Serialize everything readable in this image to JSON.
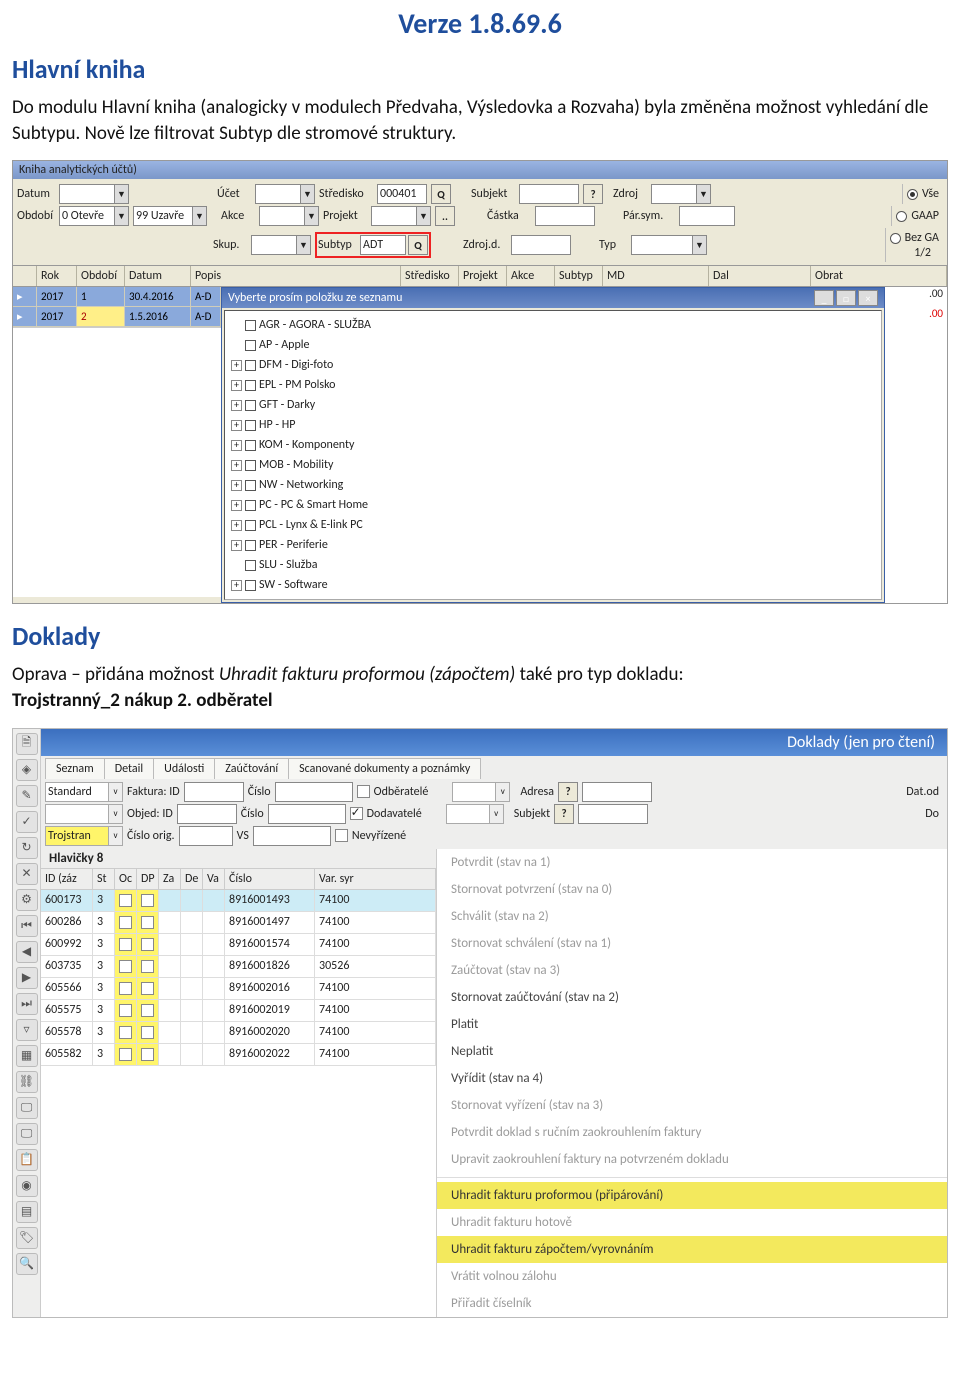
{
  "version": "Verze 1.8.69.6",
  "section1_heading": "Hlavní kniha",
  "section1_body": "Do modulu Hlavní kniha (analogicky v modulech Předvaha, Výsledovka a Rozvaha) byla změněna možnost vyhledání dle Subtypu. Nově lze filtrovat Subtyp dle stromové struktury.",
  "shot1": {
    "winTitle": "Kniha analytických účtů)",
    "labels": {
      "datum": "Datum",
      "obdobi": "Období",
      "ucet": "Účet",
      "stredisko": "Středisko",
      "subjekt": "Subjekt",
      "zdroj": "Zdroj",
      "akce": "Akce",
      "projekt": "Projekt",
      "castka": "Částka",
      "parsym": "Pár.sym.",
      "skup": "Skup.",
      "subtyp": "Subtyp",
      "zdrojd": "Zdroj.d.",
      "typ": "Typ"
    },
    "values": {
      "obdobiFrom": "0 Otevře",
      "obdobiTo": "99 Uzavře",
      "stredisko": "000401",
      "subtyp": "ADT"
    },
    "radios": {
      "vse": "Vše",
      "gaap": "GAAP",
      "bezga": "Bez GA"
    },
    "olap": "1/2",
    "columns": [
      "Rok",
      "Období",
      "Datum",
      "Popis",
      "Středisko",
      "Projekt",
      "Akce",
      "Subtyp",
      "MD",
      "Dal",
      "Obrat"
    ],
    "rows": [
      {
        "rok": "2017",
        "obdobi": "1",
        "datum": "30.4.2016",
        "popis": "A-D"
      },
      {
        "rok": "2017",
        "obdobi": "2",
        "datum": "1.5.2016",
        "popis": "A-D"
      }
    ],
    "rightcol": [
      ".00",
      ".00"
    ],
    "popup_title": "Vyberte prosím položku ze seznamu",
    "tree": [
      {
        "exp": "",
        "label": "AGR - AGORA - SLUŽBA"
      },
      {
        "exp": "",
        "label": "AP - Apple"
      },
      {
        "exp": "+",
        "label": "DFM - Digi-foto"
      },
      {
        "exp": "+",
        "label": "EPL - PM Polsko"
      },
      {
        "exp": "+",
        "label": "GFT - Darky"
      },
      {
        "exp": "+",
        "label": "HP - HP"
      },
      {
        "exp": "+",
        "label": "KOM - Komponenty"
      },
      {
        "exp": "+",
        "label": "MOB - Mobility"
      },
      {
        "exp": "+",
        "label": "NW - Networking"
      },
      {
        "exp": "+",
        "label": "PC - PC & Smart Home"
      },
      {
        "exp": "+",
        "label": "PCL - Lynx & E-link PC"
      },
      {
        "exp": "+",
        "label": "PER - Periferie"
      },
      {
        "exp": "",
        "label": "SLU - Služba"
      },
      {
        "exp": "+",
        "label": "SW - Software"
      }
    ]
  },
  "section2_heading": "Doklady",
  "section2_body_pre": "Oprava – přidána možnost ",
  "section2_body_em": "Uhradit fakturu proformou (zápočtem)",
  "section2_body_post": " také pro typ dokladu: ",
  "section2_body_bold": "Trojstranný_2 nákup 2. odběratel",
  "shot2": {
    "winTitle": "Doklady (jen pro čtení)",
    "tabs": [
      "Seznam",
      "Detail",
      "Události",
      "Zaúčtování",
      "Scanované dokumenty a poznámky"
    ],
    "labels": {
      "standard": "Standard",
      "fakturaId": "Faktura: ID",
      "cislo": "Číslo",
      "odberatele": "Odběratelé",
      "dodavatele": "Dodavatelé",
      "nevyrizene": "Nevyřízené",
      "adresa": "Adresa",
      "datod": "Dat.od",
      "objedId": "Objed: ID",
      "subjekt": "Subjekt",
      "do": "Do",
      "trojstran": "Trojstran",
      "cisloOrig": "Číslo orig.",
      "vs": "VS"
    },
    "hlav_label": "Hlavičky  8",
    "columns": [
      "ID (záz",
      "St",
      "Oc",
      "DP",
      "Za",
      "De",
      "Va",
      "Číslo",
      "Var. syr"
    ],
    "rows": [
      {
        "id": "600173",
        "st": "3",
        "cislo": "8916001493",
        "var": "74100",
        "sel": true
      },
      {
        "id": "600286",
        "st": "3",
        "cislo": "8916001497",
        "var": "74100"
      },
      {
        "id": "600992",
        "st": "3",
        "cislo": "8916001574",
        "var": "74100"
      },
      {
        "id": "603735",
        "st": "3",
        "cislo": "8916001826",
        "var": "30526"
      },
      {
        "id": "605566",
        "st": "3",
        "cislo": "8916002016",
        "var": "74100"
      },
      {
        "id": "605575",
        "st": "3",
        "cislo": "8916002019",
        "var": "74100"
      },
      {
        "id": "605578",
        "st": "3",
        "cislo": "8916002020",
        "var": "74100"
      },
      {
        "id": "605582",
        "st": "3",
        "cislo": "8916002022",
        "var": "74100"
      }
    ],
    "menu": [
      {
        "t": "Potvrdit  (stav na 1)",
        "dis": true
      },
      {
        "t": "Stornovat potvrzení (stav na 0)",
        "dis": true
      },
      {
        "t": "Schválit  (stav na 2)",
        "dis": true
      },
      {
        "t": "Stornovat schválení  (stav na 1)",
        "dis": true
      },
      {
        "t": "Zaúčtovat  (stav na 3)",
        "dis": true
      },
      {
        "t": "Stornovat zaúčtování  (stav na 2)"
      },
      {
        "t": "Platit"
      },
      {
        "t": "Neplatit"
      },
      {
        "t": "Vyřídit  (stav na 4)"
      },
      {
        "t": "Stornovat vyřízení  (stav na 3)",
        "dis": true
      },
      {
        "t": "Potvrdit doklad s ručním zaokrouhlením faktury",
        "dis": true
      },
      {
        "t": "Upravit zaokrouhlení faktury na potvrzeném dokladu",
        "dis": true
      },
      {
        "sep": true
      },
      {
        "t": "Uhradit fakturu proformou (připárování)",
        "hl": true
      },
      {
        "t": "Uhradit fakturu hotově",
        "dis": true
      },
      {
        "t": "Uhradit fakturu zápočtem/vyrovnáním",
        "hl": true
      },
      {
        "t": "Vrátit volnou zálohu",
        "dis": true
      },
      {
        "t": "Přiřadit číselník",
        "dis": true
      }
    ]
  }
}
